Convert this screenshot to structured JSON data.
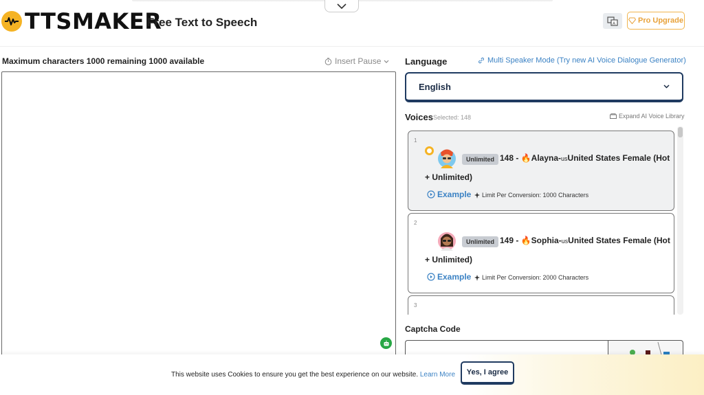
{
  "header": {
    "logo_text": "TTSMAKER",
    "tagline": "Free Text to Speech",
    "pro_label": "Pro Upgrade"
  },
  "editor": {
    "char_info": "Maximum characters 1000 remaining 1000 available",
    "insert_pause": "Insert Pause"
  },
  "language": {
    "label": "Language",
    "multi_speaker_link": "Multi Speaker Mode (Try new AI Voice Dialogue Generator)",
    "selected": "English"
  },
  "voices": {
    "label": "Voices",
    "selected_count": "Selected: 148",
    "expand_library": "Expand AI Voice Library",
    "items": [
      {
        "num": "1",
        "badge": "Unlimited",
        "id": "148 -",
        "name": "Alayna-",
        "country_code": "us",
        "desc": "United States Female (Hot",
        "desc_cont": "+ Unlimited)",
        "example": "Example",
        "limit": "Limit Per Conversion: 1000 Characters"
      },
      {
        "num": "2",
        "badge": "Unlimited",
        "id": "149 -",
        "name": "Sophia-",
        "country_code": "us",
        "desc": "United States Female (Hot",
        "desc_cont": "+ Unlimited)",
        "example": "Example",
        "limit": "Limit Per Conversion: 2000 Characters"
      },
      {
        "num": "3"
      }
    ]
  },
  "captcha": {
    "label": "Captcha Code"
  },
  "cookie": {
    "text": "This website uses Cookies to ensure you get the best experience on our website.",
    "learn_more": "Learn More",
    "agree": "Yes, I agree"
  },
  "colors": {
    "accent_yellow": "#f5b324",
    "link_blue": "#3b82c4",
    "navy": "#1f3a60",
    "pro_orange": "#e8a23a"
  }
}
